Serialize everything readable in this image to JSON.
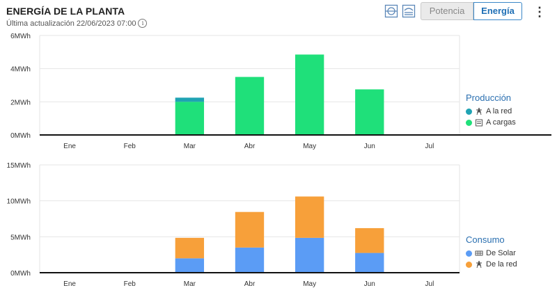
{
  "header": {
    "title": "ENERGÍA DE LA PLANTA",
    "updated_label": "Última actualización",
    "updated_value": "22/06/2023 07:00",
    "info_icon": "i"
  },
  "toolbar": {
    "icon1": "single-line-icon",
    "icon2": "layers-icon",
    "potencia_label": "Potencia",
    "energia_label": "Energía",
    "menu_label": "⋮"
  },
  "colors": {
    "a_la_red": "#1fa3b3",
    "a_cargas": "#1fe07a",
    "de_solar": "#5b9cf5",
    "de_la_red": "#f7a03a",
    "legend_title": "#2a6fb0"
  },
  "legend_production": {
    "title": "Producción",
    "items": [
      {
        "label": "A la red",
        "icon": "grid-tower-icon"
      },
      {
        "label": "A cargas",
        "icon": "building-icon"
      }
    ]
  },
  "legend_consumption": {
    "title": "Consumo",
    "items": [
      {
        "label": "De Solar",
        "icon": "solar-panel-icon"
      },
      {
        "label": "De la red",
        "icon": "grid-tower-icon"
      }
    ]
  },
  "chart_data": [
    {
      "type": "bar",
      "stacked": true,
      "categories": [
        "Ene",
        "Feb",
        "Mar",
        "Abr",
        "May",
        "Jun",
        "Jul"
      ],
      "y_ticks": [
        "0MWh",
        "2MWh",
        "4MWh",
        "6MWh"
      ],
      "ylim": [
        0,
        6
      ],
      "unit": "MWh",
      "grid": true,
      "legend_title": "Producción",
      "series": [
        {
          "name": "A cargas",
          "values": [
            0,
            0,
            2.0,
            3.5,
            4.85,
            2.75,
            0
          ]
        },
        {
          "name": "A la red",
          "values": [
            0,
            0,
            0.25,
            0,
            0,
            0,
            0
          ]
        }
      ]
    },
    {
      "type": "bar",
      "stacked": true,
      "categories": [
        "Ene",
        "Feb",
        "Mar",
        "Abr",
        "May",
        "Jun",
        "Jul"
      ],
      "y_ticks": [
        "0MWh",
        "5MWh",
        "10MWh",
        "15MWh"
      ],
      "ylim": [
        0,
        15
      ],
      "unit": "MWh",
      "grid": true,
      "legend_title": "Consumo",
      "series": [
        {
          "name": "De Solar",
          "values": [
            0,
            0,
            2.0,
            3.5,
            4.85,
            2.75,
            0
          ]
        },
        {
          "name": "De la red",
          "values": [
            0,
            0,
            2.85,
            4.95,
            5.75,
            3.45,
            0
          ]
        }
      ]
    }
  ]
}
